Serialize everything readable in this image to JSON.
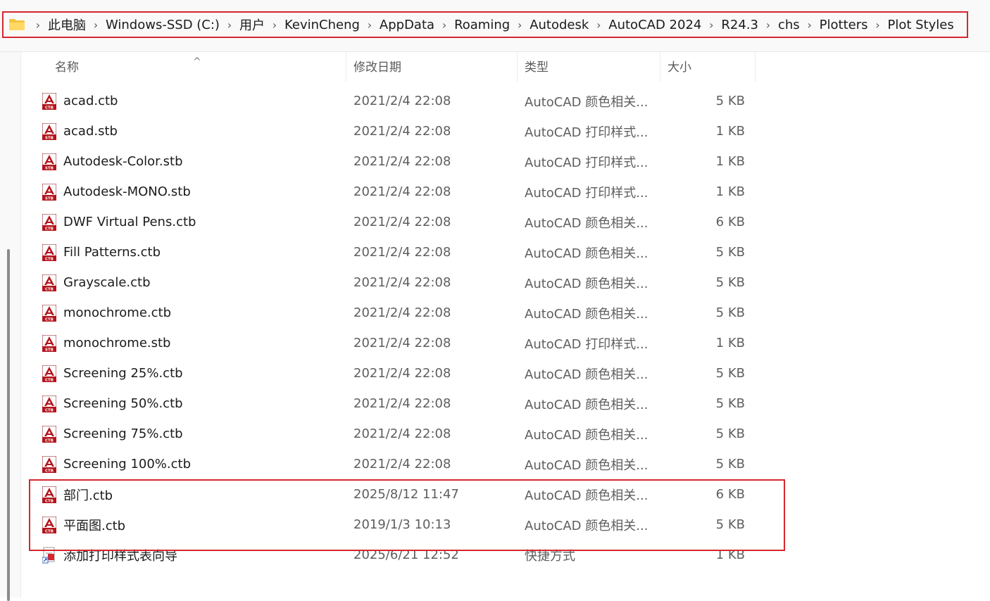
{
  "address_bar": {
    "crumbs": [
      "此电脑",
      "Windows-SSD (C:)",
      "用户",
      "KevinCheng",
      "AppData",
      "Roaming",
      "Autodesk",
      "AutoCAD 2024",
      "R24.3",
      "chs",
      "Plotters",
      "Plot Styles"
    ],
    "separator": "›"
  },
  "columns": {
    "name": "名称",
    "date": "修改日期",
    "type": "类型",
    "size": "大小"
  },
  "files": [
    {
      "name": "acad.ctb",
      "date": "2021/2/4 22:08",
      "type": "AutoCAD 颜色相关...",
      "size": "5 KB",
      "icon": "ctb-file-icon",
      "badge": "CTB"
    },
    {
      "name": "acad.stb",
      "date": "2021/2/4 22:08",
      "type": "AutoCAD 打印样式...",
      "size": "1 KB",
      "icon": "stb-file-icon",
      "badge": "STB"
    },
    {
      "name": "Autodesk-Color.stb",
      "date": "2021/2/4 22:08",
      "type": "AutoCAD 打印样式...",
      "size": "1 KB",
      "icon": "stb-file-icon",
      "badge": "STB"
    },
    {
      "name": "Autodesk-MONO.stb",
      "date": "2021/2/4 22:08",
      "type": "AutoCAD 打印样式...",
      "size": "1 KB",
      "icon": "stb-file-icon",
      "badge": "STB"
    },
    {
      "name": "DWF Virtual Pens.ctb",
      "date": "2021/2/4 22:08",
      "type": "AutoCAD 颜色相关...",
      "size": "6 KB",
      "icon": "ctb-file-icon",
      "badge": "CTB"
    },
    {
      "name": "Fill Patterns.ctb",
      "date": "2021/2/4 22:08",
      "type": "AutoCAD 颜色相关...",
      "size": "5 KB",
      "icon": "ctb-file-icon",
      "badge": "CTB"
    },
    {
      "name": "Grayscale.ctb",
      "date": "2021/2/4 22:08",
      "type": "AutoCAD 颜色相关...",
      "size": "5 KB",
      "icon": "ctb-file-icon",
      "badge": "CTB"
    },
    {
      "name": "monochrome.ctb",
      "date": "2021/2/4 22:08",
      "type": "AutoCAD 颜色相关...",
      "size": "5 KB",
      "icon": "ctb-file-icon",
      "badge": "CTB"
    },
    {
      "name": "monochrome.stb",
      "date": "2021/2/4 22:08",
      "type": "AutoCAD 打印样式...",
      "size": "1 KB",
      "icon": "stb-file-icon",
      "badge": "STB"
    },
    {
      "name": "Screening 25%.ctb",
      "date": "2021/2/4 22:08",
      "type": "AutoCAD 颜色相关...",
      "size": "5 KB",
      "icon": "ctb-file-icon",
      "badge": "CTB"
    },
    {
      "name": "Screening 50%.ctb",
      "date": "2021/2/4 22:08",
      "type": "AutoCAD 颜色相关...",
      "size": "5 KB",
      "icon": "ctb-file-icon",
      "badge": "CTB"
    },
    {
      "name": "Screening 75%.ctb",
      "date": "2021/2/4 22:08",
      "type": "AutoCAD 颜色相关...",
      "size": "5 KB",
      "icon": "ctb-file-icon",
      "badge": "CTB"
    },
    {
      "name": "Screening 100%.ctb",
      "date": "2021/2/4 22:08",
      "type": "AutoCAD 颜色相关...",
      "size": "5 KB",
      "icon": "ctb-file-icon",
      "badge": "CTB"
    },
    {
      "name": "部门.ctb",
      "date": "2025/8/12 11:47",
      "type": "AutoCAD 颜色相关...",
      "size": "6 KB",
      "icon": "ctb-file-icon",
      "badge": "CTB"
    },
    {
      "name": "平面图.ctb",
      "date": "2019/1/3 10:13",
      "type": "AutoCAD 颜色相关...",
      "size": "5 KB",
      "icon": "ctb-file-icon",
      "badge": "CTB"
    },
    {
      "name": "添加打印样式表向导",
      "date": "2025/6/21 12:52",
      "type": "快捷方式",
      "size": "1 KB",
      "icon": "shortcut-icon",
      "badge": ""
    }
  ],
  "colors": {
    "highlight": "#d7262e",
    "autocad_red": "#b3141c",
    "folder_yellow": "#f4c542"
  }
}
